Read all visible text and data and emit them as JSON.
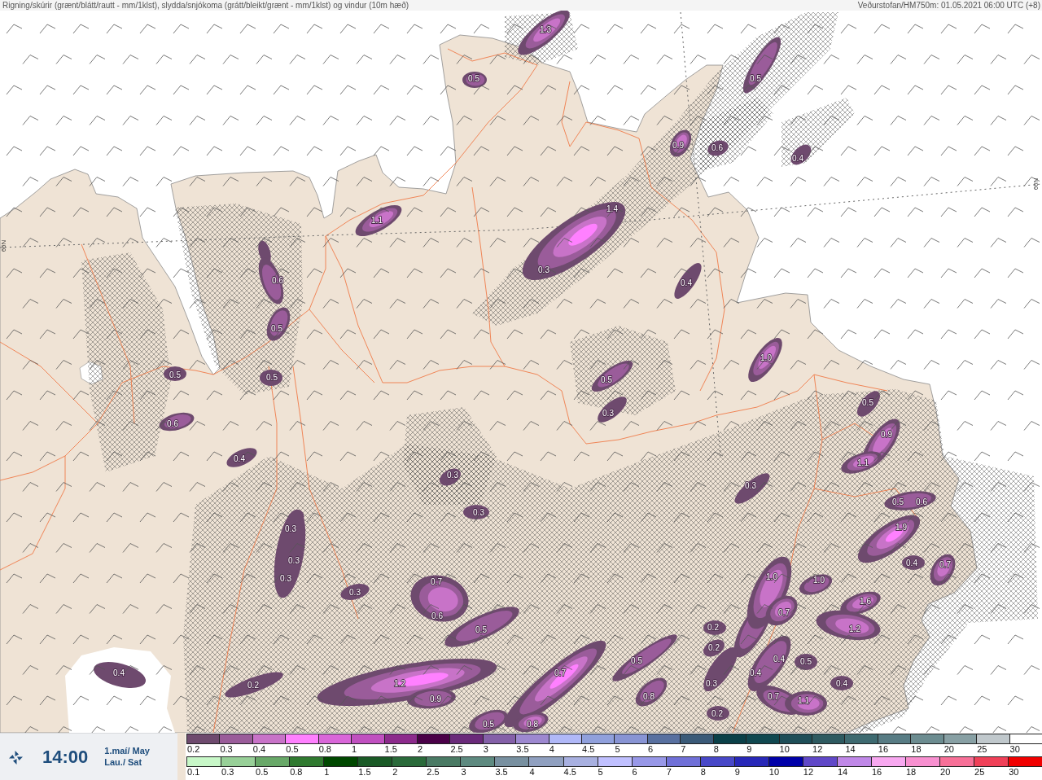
{
  "header": {
    "title": "Rigning/skúrir (grænt/blátt/rautt - mm/1klst), slydda/snjókoma (grátt/bleikt/grænt - mm/1klst) og vindur (10m hæð)",
    "source": "Veðurstofan/HM750m: 01.05.2021 06:00 UTC (+8)"
  },
  "map": {
    "latitude_labels": [
      "66N",
      "66N"
    ],
    "precipitation_values": [
      "1.3",
      "0.5",
      "0.5",
      "0.9",
      "0.6",
      "0.4",
      "1.4",
      "1.1",
      "0.3",
      "0.6",
      "0.4",
      "0.5",
      "1.0",
      "0.5",
      "0.5",
      "0.5",
      "0.5",
      "0.3",
      "0.6",
      "0.9",
      "0.4",
      "1.1",
      "0.3",
      "0.3",
      "0.5",
      "0.6",
      "0.3",
      "0.3",
      "1.9",
      "0.3",
      "0.4",
      "0.7",
      "0.3",
      "0.7",
      "1.0",
      "1.0",
      "0.3",
      "1.6",
      "0.6",
      "0.7",
      "0.5",
      "0.2",
      "1.2",
      "0.2",
      "0.5",
      "0.4",
      "0.5",
      "0.4",
      "0.7",
      "0.4",
      "0.2",
      "1.2",
      "0.3",
      "0.4",
      "0.9",
      "0.8",
      "0.7",
      "1.1",
      "0.2",
      "0.5",
      "0.8"
    ]
  },
  "time_panel": {
    "time": "14:00",
    "date": "1.maí/ May",
    "weekday": "Lau./ Sat"
  },
  "legend": [
    {
      "items": [
        {
          "label": "0.2",
          "color": "#6e4a6e"
        },
        {
          "label": "0.3",
          "color": "#9a5c9a"
        },
        {
          "label": "0.4",
          "color": "#c873c8"
        },
        {
          "label": "0.5",
          "color": "#ff80ff"
        },
        {
          "label": "0.8",
          "color": "#d966d9"
        },
        {
          "label": "1",
          "color": "#c050c0"
        },
        {
          "label": "1.5",
          "color": "#8c2a8c"
        },
        {
          "label": "2",
          "color": "#4a0048"
        },
        {
          "label": "2.5",
          "color": "#6a2a7a"
        },
        {
          "label": "3",
          "color": "#8460a8"
        },
        {
          "label": "3.5",
          "color": "#9d88d0"
        },
        {
          "label": "4",
          "color": "#b0b8f8"
        },
        {
          "label": "4.5",
          "color": "#90a0dc"
        },
        {
          "label": "5",
          "color": "#8894d4"
        },
        {
          "label": "6",
          "color": "#5870a0"
        },
        {
          "label": "7",
          "color": "#3a5a78"
        },
        {
          "label": "8",
          "color": "#0a4048"
        },
        {
          "label": "9",
          "color": "#104850"
        },
        {
          "label": "10",
          "color": "#1e4e58"
        },
        {
          "label": "12",
          "color": "#2e5a60"
        },
        {
          "label": "14",
          "color": "#3e6a70"
        },
        {
          "label": "16",
          "color": "#587c84"
        },
        {
          "label": "18",
          "color": "#6c8c90"
        },
        {
          "label": "20",
          "color": "#88a0a4"
        },
        {
          "label": "25",
          "color": "#c0c8cc"
        },
        {
          "label": "30",
          "color": "#ffffff"
        }
      ]
    },
    {
      "items": [
        {
          "label": "0.1",
          "color": "#c8f8c8"
        },
        {
          "label": "0.3",
          "color": "#98d098"
        },
        {
          "label": "0.5",
          "color": "#68a868"
        },
        {
          "label": "0.8",
          "color": "#307a30"
        },
        {
          "label": "1",
          "color": "#004800"
        },
        {
          "label": "1.5",
          "color": "#1a5a26"
        },
        {
          "label": "2",
          "color": "#2a6a3a"
        },
        {
          "label": "2.5",
          "color": "#4a7a64"
        },
        {
          "label": "3",
          "color": "#5e8a80"
        },
        {
          "label": "3.5",
          "color": "#7890a0"
        },
        {
          "label": "4",
          "color": "#90a0c0"
        },
        {
          "label": "4.5",
          "color": "#a8b0e0"
        },
        {
          "label": "5",
          "color": "#c0c0ff"
        },
        {
          "label": "6",
          "color": "#9898e8"
        },
        {
          "label": "7",
          "color": "#7070d8"
        },
        {
          "label": "8",
          "color": "#4848c8"
        },
        {
          "label": "9",
          "color": "#2828b8"
        },
        {
          "label": "10",
          "color": "#0000a8"
        },
        {
          "label": "12",
          "color": "#6048c8"
        },
        {
          "label": "14",
          "color": "#c088e8"
        },
        {
          "label": "16",
          "color": "#f8a8f0"
        },
        {
          "label": "18",
          "color": "#f890d0"
        },
        {
          "label": "20",
          "color": "#f87098"
        },
        {
          "label": "25",
          "color": "#f04058"
        },
        {
          "label": "30",
          "color": "#f00000"
        }
      ]
    }
  ]
}
